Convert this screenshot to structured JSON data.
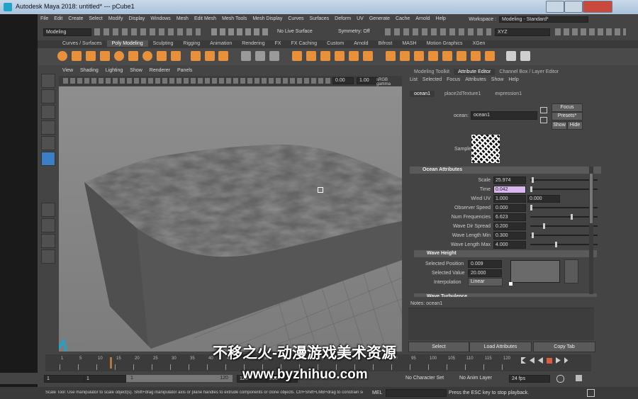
{
  "window": {
    "title": "Autodesk Maya 2018: untitled*   ---   pCube1"
  },
  "menubar": {
    "items": [
      "File",
      "Edit",
      "Create",
      "Select",
      "Modify",
      "Display",
      "Windows",
      "Mesh",
      "Edit Mesh",
      "Mesh Tools",
      "Mesh Display",
      "Curves",
      "Surfaces",
      "Deform",
      "UV",
      "Generate",
      "Cache",
      "Arnold",
      "Help"
    ]
  },
  "workspace": {
    "label": "Workspace :",
    "value": "Modeling - Standard*"
  },
  "toolbar": {
    "mode": "Modeling",
    "live_surface": "No Live Surface",
    "symmetry": "Symmetry: Off",
    "xyz": "XYZ"
  },
  "shelf": {
    "tabs": [
      "Curves / Surfaces",
      "Poly Modeling",
      "Sculpting",
      "Rigging",
      "Animation",
      "Rendering",
      "FX",
      "FX Caching",
      "Custom",
      "Arnold",
      "Bifrost",
      "MASH",
      "Motion Graphics",
      "XGen"
    ]
  },
  "viewport": {
    "menu": [
      "View",
      "Shading",
      "Lighting",
      "Show",
      "Renderer",
      "Panels"
    ],
    "field_a": "0.00",
    "field_b": "1.00",
    "colorspace": "sRGB gamma"
  },
  "panel": {
    "tabs": [
      "Modeling Toolkit",
      "Attribute Editor",
      "Channel Box / Layer Editor"
    ],
    "menu": [
      "List",
      "Selected",
      "Focus",
      "Attributes",
      "Show",
      "Help"
    ],
    "node_tabs": [
      "ocean1",
      "place2dTexture1",
      "expression1"
    ],
    "node_label": "ocean:",
    "node_value": "ocean1",
    "buttons": {
      "focus": "Focus",
      "presets": "Presets*",
      "show": "Show",
      "hide": "Hide"
    },
    "sample_label": "Sample",
    "sections": {
      "ocean_attributes": "Ocean Attributes",
      "wave_height": "Wave Height",
      "wave_turbulence": "Wave Turbulence"
    },
    "attributes": [
      {
        "label": "Scale",
        "value": "25.974",
        "slider": 0.02
      },
      {
        "label": "Time",
        "value": "0.042",
        "slider": 0.0
      },
      {
        "label": "Wind UV",
        "value": "1.000",
        "value2": "0.000"
      },
      {
        "label": "Observer Speed",
        "value": "0.000",
        "slider": 0.0
      },
      {
        "label": "Num Frequencies",
        "value": "6.623",
        "slider": 0.62
      },
      {
        "label": "Wave Dir Spread",
        "value": "0.200",
        "slider": 0.2
      },
      {
        "label": "Wave Length Min",
        "value": "0.300",
        "slider": 0.02
      },
      {
        "label": "Wave Length Max",
        "value": "4.000",
        "slider": 0.38
      }
    ],
    "wave_height": {
      "selected_position_label": "Selected Position",
      "selected_position": "0.009",
      "selected_value_label": "Selected Value",
      "selected_value": "20.000",
      "interpolation_label": "Interpolation",
      "interpolation": "Linear"
    },
    "notes": "Notes:  ocean1",
    "bottom_buttons": [
      "Select",
      "Load Attributes",
      "Copy Tab"
    ]
  },
  "timeline": {
    "ticks": [
      "1",
      "5",
      "10",
      "15",
      "20",
      "25",
      "30",
      "35",
      "40",
      "45",
      "50",
      "55",
      "60",
      "65",
      "70",
      "75",
      "80",
      "85",
      "90",
      "95",
      "100",
      "105",
      "110",
      "115",
      "120"
    ]
  },
  "range": {
    "start": "1",
    "start2": "1",
    "mid": "1",
    "end_inner": "120",
    "end": "120",
    "end2": "200",
    "character_set": "No Character Set",
    "anim_layer": "No Anim Layer",
    "fps": "24 fps"
  },
  "commandline": {
    "help": "Scale Tool: Use manipulator to scale object(s). Shift+drag manipulator axis or plane handles to extrude components or clone objects. Ctrl+Shift+LMB+drag to constrain sc",
    "mel": "MEL",
    "status": "Press the ESC key to stop playback."
  },
  "watermark": {
    "line1": "不移之火-动漫游戏美术资源",
    "line2": "www.byzhihuo.com"
  },
  "colors": {
    "accent_orange": "#e8913a",
    "field_highlight": "#d9b8f0",
    "maya_logo": "#1fa3c9"
  }
}
